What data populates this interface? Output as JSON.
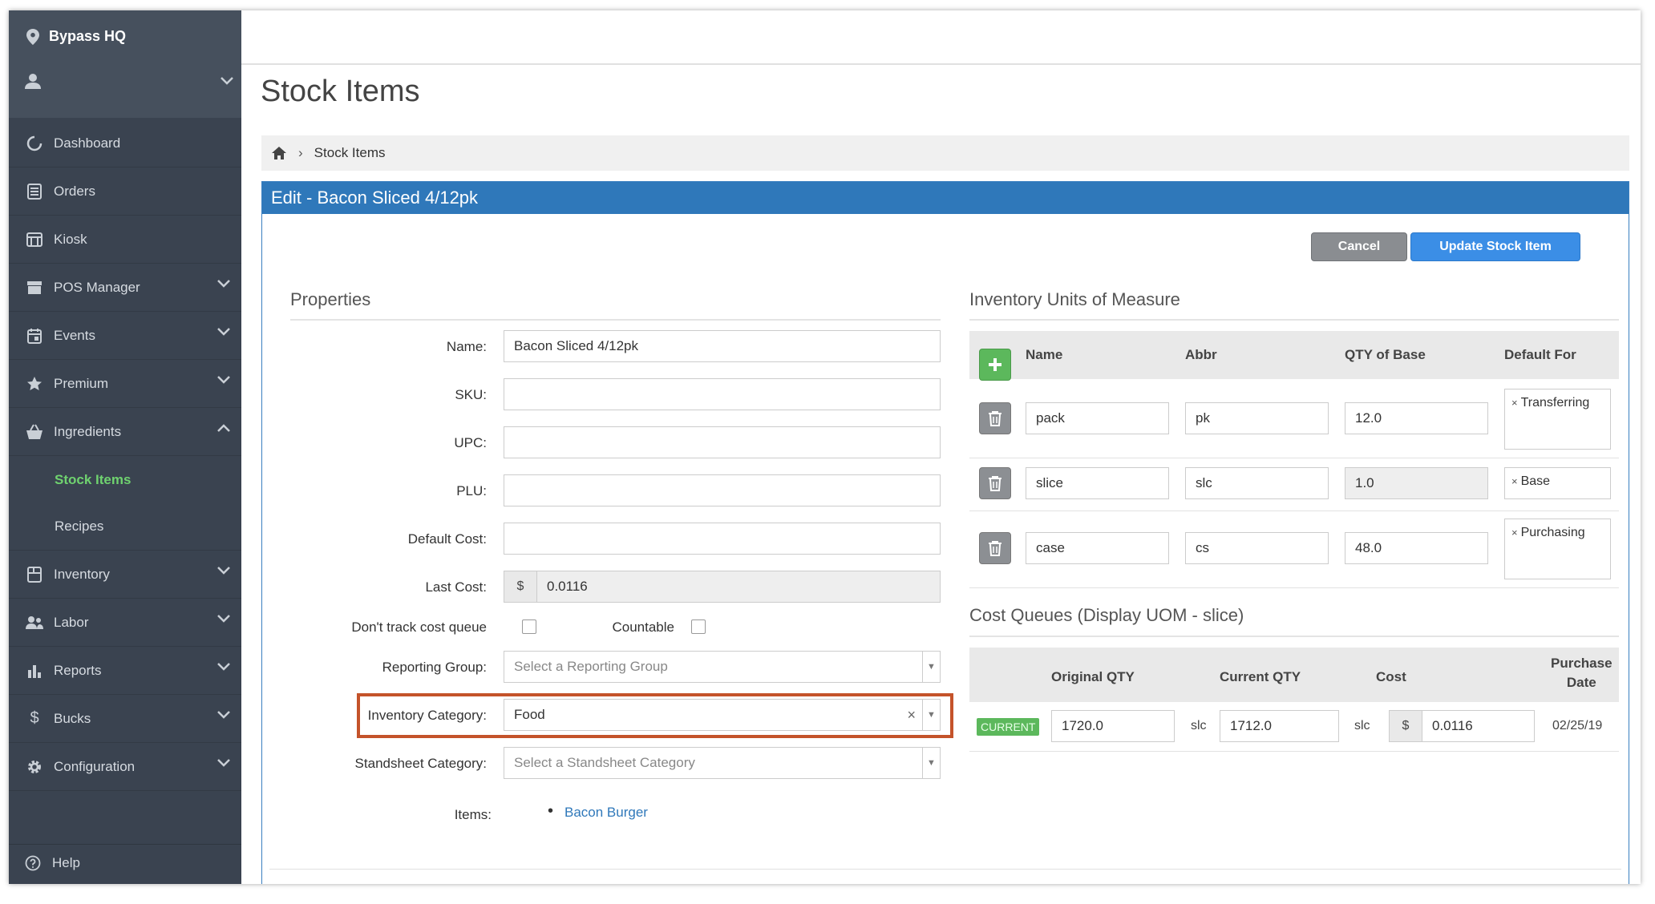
{
  "sidebar": {
    "location": "Bypass HQ",
    "nav": [
      {
        "label": "Dashboard"
      },
      {
        "label": "Orders"
      },
      {
        "label": "Kiosk"
      },
      {
        "label": "POS Manager"
      },
      {
        "label": "Events"
      },
      {
        "label": "Premium"
      },
      {
        "label": "Ingredients"
      },
      {
        "label": "Stock Items"
      },
      {
        "label": "Recipes"
      },
      {
        "label": "Inventory"
      },
      {
        "label": "Labor"
      },
      {
        "label": "Reports"
      },
      {
        "label": "Bucks"
      },
      {
        "label": "Configuration"
      }
    ],
    "help": "Help"
  },
  "page": {
    "title": "Stock Items",
    "breadcrumb": "Stock Items",
    "panel_title": "Edit - Bacon Sliced 4/12pk",
    "cancel": "Cancel",
    "update": "Update Stock Item"
  },
  "properties": {
    "title": "Properties",
    "name_label": "Name:",
    "name_value": "Bacon Sliced 4/12pk",
    "sku_label": "SKU:",
    "upc_label": "UPC:",
    "plu_label": "PLU:",
    "default_cost_label": "Default Cost:",
    "last_cost_label": "Last Cost:",
    "currency": "$",
    "last_cost_value": "0.0116",
    "dont_track_label": "Don't track cost queue",
    "countable_label": "Countable",
    "reporting_group_label": "Reporting Group:",
    "reporting_group_placeholder": "Select a Reporting Group",
    "inventory_category_label": "Inventory Category:",
    "inventory_category_value": "Food",
    "clear": "×",
    "standsheet_label": "Standsheet Category:",
    "standsheet_placeholder": "Select a Standsheet Category",
    "items_label": "Items:",
    "items": [
      "Bacon Burger"
    ]
  },
  "uom": {
    "title": "Inventory Units of Measure",
    "headers": {
      "name": "Name",
      "abbr": "Abbr",
      "qty": "QTY of Base",
      "default": "Default For"
    },
    "rows": [
      {
        "name": "pack",
        "abbr": "pk",
        "qty": "12.0",
        "default": "Transferring"
      },
      {
        "name": "slice",
        "abbr": "slc",
        "qty": "1.0",
        "default": "Base"
      },
      {
        "name": "case",
        "abbr": "cs",
        "qty": "48.0",
        "default": "Purchasing"
      }
    ],
    "remove": "×"
  },
  "cost_queues": {
    "title": "Cost Queues (Display UOM - slice)",
    "headers": {
      "original": "Original QTY",
      "current": "Current QTY",
      "cost": "Cost",
      "purchase1": "Purchase",
      "purchase2": "Date"
    },
    "row": {
      "badge": "CURRENT",
      "original": "1720.0",
      "unit1": "slc",
      "current": "1712.0",
      "unit2": "slc",
      "currency": "$",
      "cost": "0.0116",
      "date": "02/25/19"
    }
  }
}
